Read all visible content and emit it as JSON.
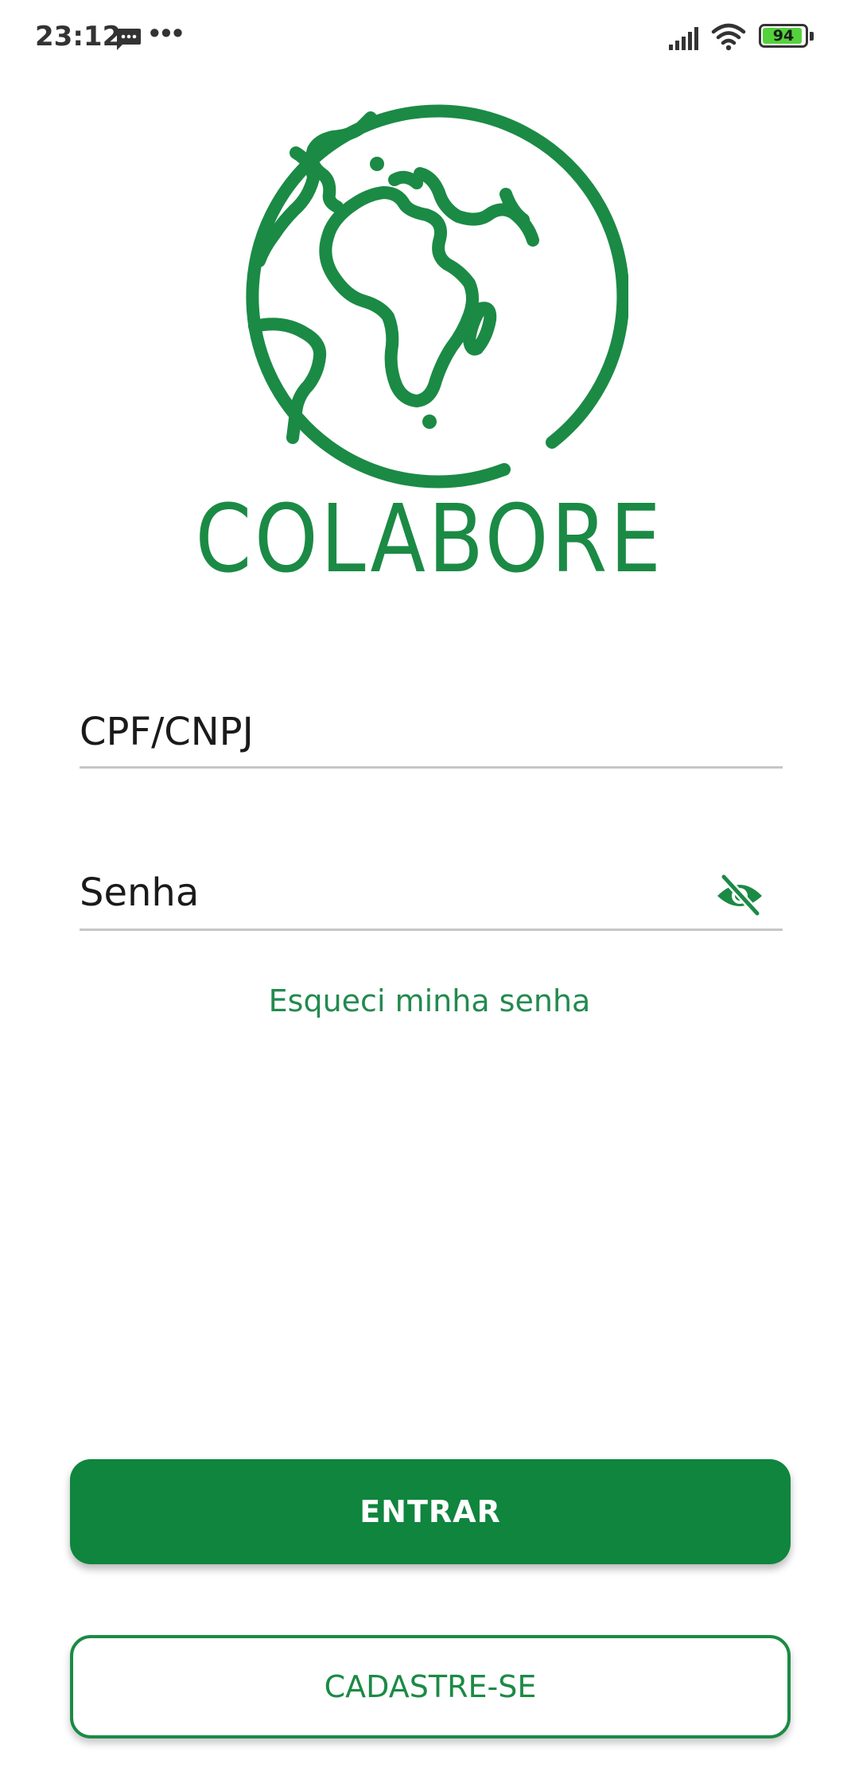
{
  "status_bar": {
    "time": "23:12",
    "dots": "•••",
    "battery_level": "94",
    "battery_fraction": 0.94,
    "icons": [
      "message-icon",
      "signal-icon",
      "wifi-icon",
      "battery-icon"
    ]
  },
  "logo": {
    "text": "COLABORE",
    "icon": "globe-icon",
    "color": "#1b8a45"
  },
  "form": {
    "cpf_label": "CPF/CNPJ",
    "password_label": "Senha",
    "password_toggle_icon": "eye-off-icon",
    "forgot_password": "Esqueci minha senha"
  },
  "buttons": {
    "login": "ENTRAR",
    "signup": "CADASTRE-SE"
  },
  "colors": {
    "primary": "#0f853e",
    "accent": "#1b8a45",
    "divider": "#c6c6c6"
  }
}
